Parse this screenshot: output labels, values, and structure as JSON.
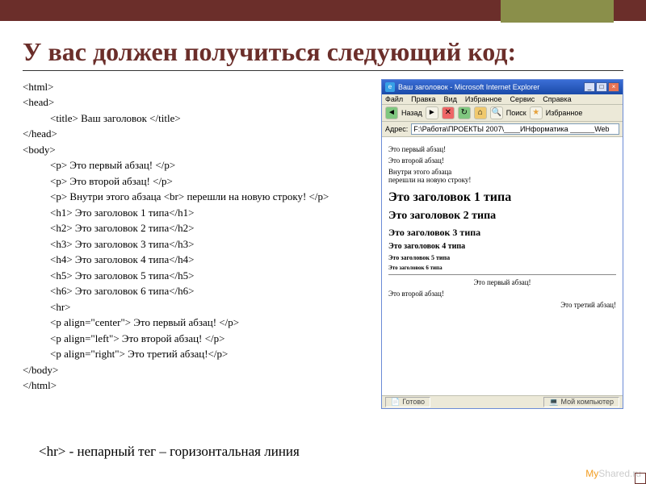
{
  "slide": {
    "title": "У вас должен получиться следующий код:",
    "footer_note": "<hr> - непарный тег – горизонтальная линия",
    "watermark_left": "My",
    "watermark_right": "Shared.ru"
  },
  "code_lines": [
    {
      "cls": "",
      "text": "<html>"
    },
    {
      "cls": "",
      "text": "<head>"
    },
    {
      "cls": "ind1",
      "text": "<title> Ваш заголовок </title>"
    },
    {
      "cls": "",
      "text": "</head>"
    },
    {
      "cls": "",
      "text": "<body>"
    },
    {
      "cls": "ind1",
      "text": "<p> Это первый абзац! </p>"
    },
    {
      "cls": "ind1",
      "text": "<p> Это второй абзац! </p>"
    },
    {
      "cls": "ind1",
      "text": "<p> Внутри этого абзаца <br> перешли на новую строку! </p>"
    },
    {
      "cls": "ind1",
      "text": "<h1> Это заголовок 1 типа</h1>"
    },
    {
      "cls": "ind1",
      "text": "<h2> Это заголовок 2 типа</h2>"
    },
    {
      "cls": "ind1",
      "text": "<h3> Это заголовок 3 типа</h3>"
    },
    {
      "cls": "ind1",
      "text": "<h4> Это заголовок 4 типа</h4>"
    },
    {
      "cls": "ind1",
      "text": "<h5> Это заголовок 5 типа</h5>"
    },
    {
      "cls": "ind1",
      "text": "<h6> Это заголовок 6 типа</h6>"
    },
    {
      "cls": "ind1",
      "text": "<hr>"
    },
    {
      "cls": "ind1",
      "text": "<p align=\"center\"> Это первый абзац! </p>"
    },
    {
      "cls": "ind1",
      "text": "<p align=\"left\"> Это второй абзац! </p>"
    },
    {
      "cls": "ind1",
      "text": "<p align=\"right\"> Это третий абзац!</p>"
    },
    {
      "cls": "",
      "text": "</body>"
    },
    {
      "cls": "",
      "text": "</html>"
    }
  ],
  "browser": {
    "title": "Ваш заголовок - Microsoft Internet Explorer",
    "menu": [
      "Файл",
      "Правка",
      "Вид",
      "Избранное",
      "Сервис",
      "Справка"
    ],
    "toolbar": {
      "back_label": "Назад",
      "search_label": "Поиск",
      "fav_label": "Избранное"
    },
    "address_label": "Адрес:",
    "address_value": "F:\\Работа\\ПРОЕКТЫ 2007\\____ИНформатика ______Web",
    "page": {
      "p1": "Это первый абзац!",
      "p2": "Это второй абзац!",
      "p3a": "Внутри этого абзаца",
      "p3b": "перешли на новую строку!",
      "h1": "Это заголовок 1 типа",
      "h2": "Это заголовок 2 типа",
      "h3": "Это заголовок 3 типа",
      "h4": "Это заголовок 4 типа",
      "h5": "Это заголовок 5 типа",
      "h6": "Это заголовок 6 типа",
      "pc": "Это первый абзац!",
      "pl": "Это второй абзац!",
      "pr": "Это третий абзац!"
    },
    "status": {
      "done": "Готово",
      "zone": "Мой компьютер"
    }
  }
}
